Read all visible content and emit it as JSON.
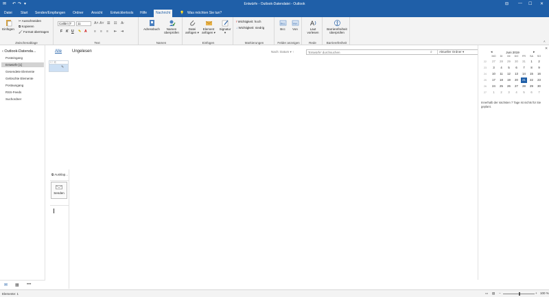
{
  "window": {
    "title": "Entwürfe - Outlook-Datendatei  -  Outlook",
    "qa": [
      "✉",
      "↶",
      "↷",
      "▾"
    ],
    "controls": [
      "⊟",
      "—",
      "☐",
      "✕"
    ]
  },
  "tabs": [
    {
      "label": "Datei"
    },
    {
      "label": "Start"
    },
    {
      "label": "Senden/Empfangen"
    },
    {
      "label": "Ordner"
    },
    {
      "label": "Ansicht"
    },
    {
      "label": "Entwicklertools"
    },
    {
      "label": "Hilfe"
    },
    {
      "label": "Nachricht"
    }
  ],
  "tell_me": "Was möchten Sie tun?",
  "ribbon": {
    "clipboard": {
      "paste": "Einfügen",
      "cut": "Ausschneiden",
      "copy": "Kopieren",
      "format_painter": "Format übertragen",
      "label": "Zwischenablage"
    },
    "text": {
      "font": "Calibri (T",
      "size": "11",
      "label": "Text",
      "bold": "F",
      "italic": "K",
      "underline": "U"
    },
    "names": {
      "address_book": "Adressbuch",
      "check_names_1": "Namen",
      "check_names_2": "überprüfen",
      "label": "Namen"
    },
    "include": {
      "attach_1": "Datei",
      "attach_2": "anfügen ▾",
      "item_1": "Element",
      "item_2": "anfügen ▾",
      "signature_1": "Signatur",
      "signature_2": "▾",
      "label": "Einfügen"
    },
    "tags": {
      "high": "Wichtigkeit: hoch",
      "low": "Wichtigkeit: niedrig",
      "label": "Markierungen"
    },
    "fields": {
      "bcc": "Bcc",
      "from": "Von",
      "label": "Felder anzeigen"
    },
    "speech": {
      "read_1": "Laut",
      "read_2": "vorlesen",
      "label": "Rede"
    },
    "accessibility": {
      "check_1": "Barrierefreiheit",
      "check_2": "überprüfen",
      "label": "Barrierefreiheit"
    }
  },
  "nav": {
    "root": "‹ Outlook-Datenda...",
    "items": [
      {
        "label": "Posteingang"
      },
      {
        "label": "Entwürfe [1]"
      },
      {
        "label": "Gesendete Elemente"
      },
      {
        "label": "Gelöschte Elemente"
      },
      {
        "label": "Postausgang"
      },
      {
        "label": "RSS-Feeds"
      },
      {
        "label": "Suchordner"
      }
    ]
  },
  "list": {
    "filter_all": "Alle",
    "filter_unread": "Ungelesen",
    "sort": "Nach: Datum ▾  ↑",
    "search_placeholder": "'Entwürfe' durchsuchen",
    "search_scope": "Aktueller Ordner ▾"
  },
  "compose": {
    "popout": "Ausklap...",
    "send": "Senden"
  },
  "peek": {
    "month": "Juni 2019",
    "dow": [
      "MO",
      "DI",
      "MI",
      "DO",
      "FR",
      "SA",
      "SO"
    ],
    "weeks": [
      "22",
      "23",
      "24",
      "25",
      "26",
      "27"
    ],
    "days": [
      [
        "27",
        "28",
        "29",
        "30",
        "31",
        "1",
        "2"
      ],
      [
        "3",
        "4",
        "5",
        "6",
        "7",
        "8",
        "9"
      ],
      [
        "10",
        "11",
        "12",
        "13",
        "14",
        "15",
        "16"
      ],
      [
        "17",
        "18",
        "19",
        "20",
        "21",
        "22",
        "23"
      ],
      [
        "24",
        "25",
        "26",
        "27",
        "28",
        "29",
        "30"
      ],
      [
        "1",
        "2",
        "3",
        "4",
        "5",
        "6",
        "7"
      ]
    ],
    "today": "21",
    "no_appointments": "Innerhalb der nächsten 7 Tage ist nichts für Sie geplant."
  },
  "status": {
    "items": "Elemente: 1",
    "zoom": "100 %"
  },
  "colors": {
    "accent": "#1f5fa8"
  }
}
